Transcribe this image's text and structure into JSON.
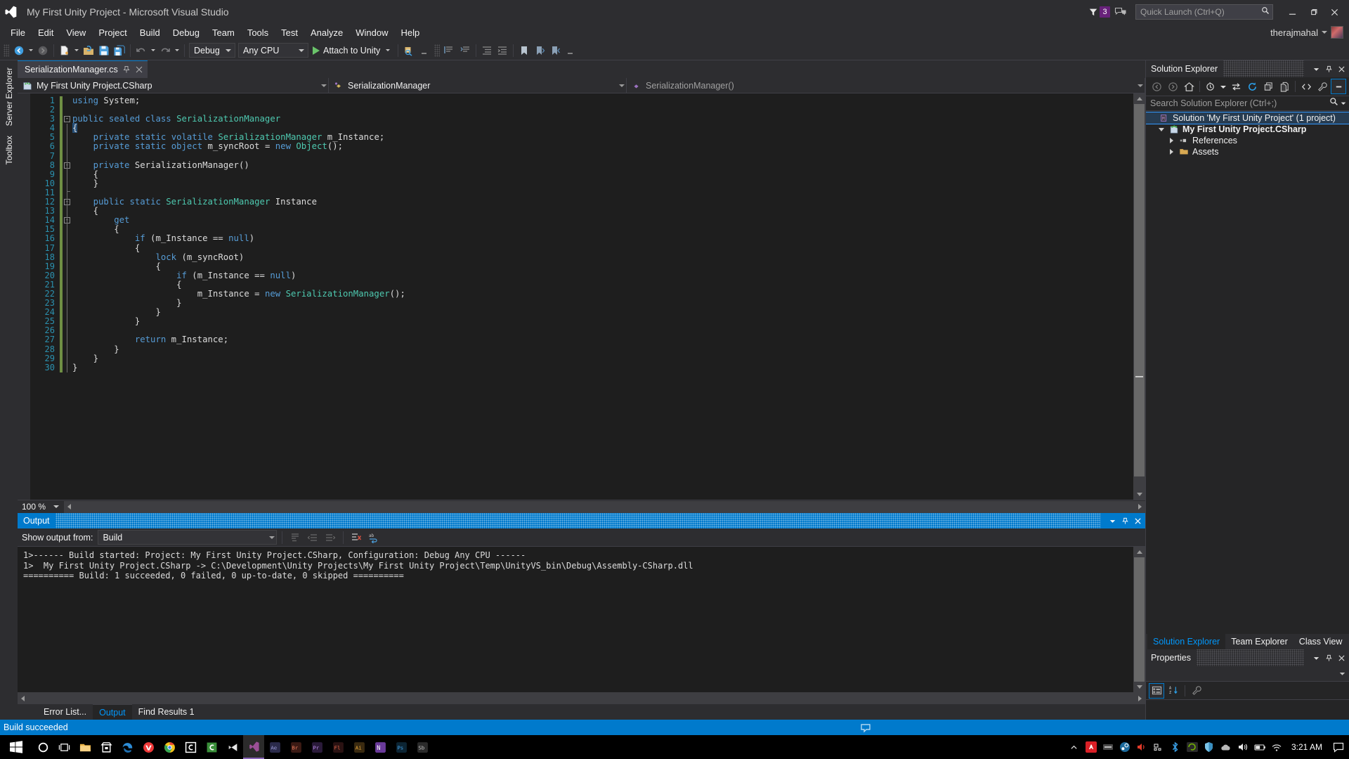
{
  "window": {
    "title": "My First Unity Project - Microsoft Visual Studio",
    "logo_icon": "visual-studio-logo",
    "minimize_icon": "minimize-icon",
    "restore_icon": "restore-icon",
    "close_icon": "close-icon"
  },
  "titlebar": {
    "notification_icon": "funnel-icon",
    "notification_count": "3",
    "feedback_icon": "feedback-icon",
    "quick_launch_placeholder": "Quick Launch (Ctrl+Q)",
    "quick_launch_value": "",
    "search_icon": "magnifier-icon"
  },
  "account": {
    "user_name": "therajmahal",
    "dropdown_icon": "chevron-down-icon",
    "avatar": "user-avatar"
  },
  "menu": {
    "items": [
      {
        "label": "File"
      },
      {
        "label": "Edit"
      },
      {
        "label": "View"
      },
      {
        "label": "Project"
      },
      {
        "label": "Build"
      },
      {
        "label": "Debug"
      },
      {
        "label": "Team"
      },
      {
        "label": "Tools"
      },
      {
        "label": "Test"
      },
      {
        "label": "Analyze"
      },
      {
        "label": "Window"
      },
      {
        "label": "Help"
      }
    ]
  },
  "toolbar": {
    "navigate_back_icon": "navigate-back-icon",
    "navigate_forward_icon": "navigate-forward-icon",
    "new_item_icon": "new-item-icon",
    "open_file_icon": "open-file-icon",
    "save_icon": "save-icon",
    "save_all_icon": "save-all-icon",
    "undo_icon": "undo-icon",
    "redo_icon": "redo-icon",
    "config_value": "Debug",
    "platform_value": "Any CPU",
    "run_label": "Attach to Unity",
    "run_icon": "play-triangle-icon",
    "find_icon": "find-in-files-icon",
    "comment_icon": "comment-icon",
    "uncomment_icon": "uncomment-icon",
    "indent_icon": "increase-indent-icon",
    "outdent_icon": "decrease-indent-icon",
    "bookmark_icon": "bookmark-icon",
    "prev_bookmark_icon": "previous-bookmark-icon",
    "next_bookmark_icon": "next-bookmark-icon",
    "overflow_icon": "toolbar-overflow-icon"
  },
  "left_dock": {
    "tabs": [
      {
        "label": "Server Explorer"
      },
      {
        "label": "Toolbox"
      }
    ]
  },
  "editor": {
    "tab_label": "SerializationManager.cs",
    "tab_pin_icon": "pin-icon",
    "tab_close_icon": "close-icon",
    "breadcrumb": {
      "project": "My First Unity Project.CSharp",
      "project_icon": "csharp-project-icon",
      "type": "SerializationManager",
      "type_icon": "class-icon",
      "member": "SerializationManager()",
      "member_icon": "method-icon"
    },
    "zoom_level": "100 %",
    "line_numbers": [
      1,
      2,
      3,
      4,
      5,
      6,
      7,
      8,
      9,
      10,
      11,
      12,
      13,
      14,
      15,
      16,
      17,
      18,
      19,
      20,
      21,
      22,
      23,
      24,
      25,
      26,
      27,
      28,
      29,
      30
    ],
    "lines": [
      {
        "n": 1,
        "indent": 0,
        "tokens": [
          {
            "t": "using ",
            "c": "kw"
          },
          {
            "t": "System;",
            "c": "pl"
          }
        ]
      },
      {
        "n": 2,
        "indent": 0,
        "tokens": []
      },
      {
        "n": 3,
        "indent": 0,
        "fold": "minus",
        "tokens": [
          {
            "t": "public ",
            "c": "kw"
          },
          {
            "t": "sealed ",
            "c": "kw"
          },
          {
            "t": "class ",
            "c": "kw"
          },
          {
            "t": "SerializationManager",
            "c": "type"
          }
        ]
      },
      {
        "n": 4,
        "indent": 0,
        "tokens": [
          {
            "t": "{",
            "c": "cursor"
          }
        ]
      },
      {
        "n": 5,
        "indent": 1,
        "tokens": [
          {
            "t": "private ",
            "c": "kw"
          },
          {
            "t": "static ",
            "c": "kw"
          },
          {
            "t": "volatile ",
            "c": "kw"
          },
          {
            "t": "SerializationManager",
            "c": "type"
          },
          {
            "t": " m_Instance;",
            "c": "pl"
          }
        ]
      },
      {
        "n": 6,
        "indent": 1,
        "tokens": [
          {
            "t": "private ",
            "c": "kw"
          },
          {
            "t": "static ",
            "c": "kw"
          },
          {
            "t": "object",
            "c": "kw"
          },
          {
            "t": " m_syncRoot = ",
            "c": "pl"
          },
          {
            "t": "new ",
            "c": "kw"
          },
          {
            "t": "Object",
            "c": "type"
          },
          {
            "t": "();",
            "c": "pl"
          }
        ]
      },
      {
        "n": 7,
        "indent": 0,
        "tokens": []
      },
      {
        "n": 8,
        "indent": 1,
        "fold": "minus",
        "tokens": [
          {
            "t": "private ",
            "c": "kw"
          },
          {
            "t": "SerializationManager",
            "c": "pl"
          },
          {
            "t": "()",
            "c": "pl"
          }
        ]
      },
      {
        "n": 9,
        "indent": 1,
        "tokens": [
          {
            "t": "{",
            "c": "pl"
          }
        ]
      },
      {
        "n": 10,
        "indent": 1,
        "tokens": [
          {
            "t": "}",
            "c": "pl"
          }
        ]
      },
      {
        "n": 11,
        "indent": 0,
        "tokens": []
      },
      {
        "n": 12,
        "indent": 1,
        "fold": "minus",
        "tokens": [
          {
            "t": "public ",
            "c": "kw"
          },
          {
            "t": "static ",
            "c": "kw"
          },
          {
            "t": "SerializationManager",
            "c": "type"
          },
          {
            "t": " Instance",
            "c": "pl"
          }
        ]
      },
      {
        "n": 13,
        "indent": 1,
        "tokens": [
          {
            "t": "{",
            "c": "pl"
          }
        ]
      },
      {
        "n": 14,
        "indent": 2,
        "fold": "minus",
        "tokens": [
          {
            "t": "get",
            "c": "kw"
          }
        ]
      },
      {
        "n": 15,
        "indent": 2,
        "tokens": [
          {
            "t": "{",
            "c": "pl"
          }
        ]
      },
      {
        "n": 16,
        "indent": 3,
        "tokens": [
          {
            "t": "if",
            "c": "kw"
          },
          {
            "t": " (m_Instance == ",
            "c": "pl"
          },
          {
            "t": "null",
            "c": "kw"
          },
          {
            "t": ")",
            "c": "pl"
          }
        ]
      },
      {
        "n": 17,
        "indent": 3,
        "tokens": [
          {
            "t": "{",
            "c": "pl"
          }
        ]
      },
      {
        "n": 18,
        "indent": 4,
        "tokens": [
          {
            "t": "lock",
            "c": "kw"
          },
          {
            "t": " (m_syncRoot)",
            "c": "pl"
          }
        ]
      },
      {
        "n": 19,
        "indent": 4,
        "tokens": [
          {
            "t": "{",
            "c": "pl"
          }
        ]
      },
      {
        "n": 20,
        "indent": 5,
        "tokens": [
          {
            "t": "if",
            "c": "kw"
          },
          {
            "t": " (m_Instance == ",
            "c": "pl"
          },
          {
            "t": "null",
            "c": "kw"
          },
          {
            "t": ")",
            "c": "pl"
          }
        ]
      },
      {
        "n": 21,
        "indent": 5,
        "tokens": [
          {
            "t": "{",
            "c": "pl"
          }
        ]
      },
      {
        "n": 22,
        "indent": 6,
        "tokens": [
          {
            "t": "m_Instance = ",
            "c": "pl"
          },
          {
            "t": "new ",
            "c": "kw"
          },
          {
            "t": "SerializationManager",
            "c": "type"
          },
          {
            "t": "();",
            "c": "pl"
          }
        ]
      },
      {
        "n": 23,
        "indent": 5,
        "tokens": [
          {
            "t": "}",
            "c": "pl"
          }
        ]
      },
      {
        "n": 24,
        "indent": 4,
        "tokens": [
          {
            "t": "}",
            "c": "pl"
          }
        ]
      },
      {
        "n": 25,
        "indent": 3,
        "tokens": [
          {
            "t": "}",
            "c": "pl"
          }
        ]
      },
      {
        "n": 26,
        "indent": 0,
        "tokens": []
      },
      {
        "n": 27,
        "indent": 3,
        "tokens": [
          {
            "t": "return",
            "c": "kw"
          },
          {
            "t": " m_Instance;",
            "c": "pl"
          }
        ]
      },
      {
        "n": 28,
        "indent": 2,
        "tokens": [
          {
            "t": "}",
            "c": "pl"
          }
        ]
      },
      {
        "n": 29,
        "indent": 1,
        "tokens": [
          {
            "t": "}",
            "c": "pl"
          }
        ]
      },
      {
        "n": 30,
        "indent": 0,
        "tokens": [
          {
            "t": "}",
            "c": "pl"
          }
        ]
      }
    ]
  },
  "output": {
    "panel_title": "Output",
    "dropdown_icon": "chevron-down-icon",
    "pin_icon": "pin-icon",
    "close_icon": "close-icon",
    "show_output_from_label": "Show output from:",
    "source_value": "Build",
    "find_message_icon": "find-message-icon",
    "go_to_previous_icon": "go-to-previous-message-icon",
    "go_to_next_icon": "go-to-next-message-icon",
    "clear_all_icon": "clear-all-icon",
    "toggle_word_wrap_icon": "toggle-word-wrap-icon",
    "lines": [
      "1>------ Build started: Project: My First Unity Project.CSharp, Configuration: Debug Any CPU ------",
      "1>  My First Unity Project.CSharp -> C:\\Development\\Unity Projects\\My First Unity Project\\Temp\\UnityVS_bin\\Debug\\Assembly-CSharp.dll",
      "========== Build: 1 succeeded, 0 failed, 0 up-to-date, 0 skipped =========="
    ]
  },
  "bottom_tabs": [
    {
      "label": "Error List...",
      "active": false
    },
    {
      "label": "Output",
      "active": true
    },
    {
      "label": "Find Results 1",
      "active": false
    }
  ],
  "solution_explorer": {
    "title": "Solution Explorer",
    "dropdown_icon": "chevron-down-icon",
    "pin_icon": "pin-icon",
    "close_icon": "close-icon",
    "toolbar": {
      "back_icon": "navigate-back-icon",
      "forward_icon": "navigate-forward-icon",
      "home_icon": "home-icon",
      "pending_changes_icon": "pending-changes-filter-icon",
      "sync_icon": "sync-with-active-document-icon",
      "refresh_icon": "refresh-icon",
      "collapse_all_icon": "collapse-all-icon",
      "properties_window_icon": "properties-window-icon",
      "show_all_files_icon": "show-all-files-icon",
      "view_code_icon": "view-code-icon",
      "preview_selected_icon": "preview-selected-items-icon"
    },
    "search_placeholder": "Search Solution Explorer (Ctrl+;)",
    "search_value": "",
    "search_icon": "magnifier-icon",
    "search_dropdown_icon": "chevron-down-icon",
    "tree": [
      {
        "label": "Solution 'My First Unity Project' (1 project)",
        "icon": "solution-icon",
        "depth": 0,
        "twist": "none",
        "bold": false,
        "selected": true
      },
      {
        "label": "My First Unity Project.CSharp",
        "icon": "csharp-project-icon",
        "depth": 1,
        "twist": "open",
        "bold": true,
        "selected": false
      },
      {
        "label": "References",
        "icon": "references-icon",
        "depth": 2,
        "twist": "closed",
        "bold": false,
        "selected": false
      },
      {
        "label": "Assets",
        "icon": "folder-icon",
        "depth": 2,
        "twist": "closed",
        "bold": false,
        "selected": false
      }
    ]
  },
  "dock_tabs": [
    {
      "label": "Solution Explorer",
      "active": true
    },
    {
      "label": "Team Explorer",
      "active": false
    },
    {
      "label": "Class View",
      "active": false
    }
  ],
  "properties": {
    "title": "Properties",
    "dropdown_icon": "chevron-down-icon",
    "pin_icon": "pin-icon",
    "close_icon": "close-icon",
    "object_dropdown_icon": "chevron-down-icon",
    "categorized_icon": "categorized-view-icon",
    "alphabetical_icon": "alphabetical-sort-icon",
    "property_pages_icon": "property-pages-icon"
  },
  "statusbar": {
    "message": "Build succeeded",
    "notification_icon": "notification-icon"
  },
  "taskbar": {
    "start_icon": "windows-start-icon",
    "items": [
      {
        "icon": "cortana-search-icon",
        "active": false
      },
      {
        "icon": "task-view-icon",
        "active": false
      },
      {
        "icon": "file-explorer-icon",
        "active": false
      },
      {
        "icon": "microsoft-store-icon",
        "active": false
      },
      {
        "icon": "microsoft-edge-icon",
        "active": false
      },
      {
        "icon": "vivaldi-browser-icon",
        "active": false
      },
      {
        "icon": "google-chrome-icon",
        "active": false
      },
      {
        "icon": "c-app-icon",
        "active": false
      },
      {
        "icon": "c-app-green-icon",
        "active": false
      },
      {
        "icon": "unity-editor-icon",
        "active": false
      },
      {
        "icon": "visual-studio-icon",
        "active": true
      },
      {
        "icon": "after-effects-icon",
        "active": false
      },
      {
        "icon": "adobe-bridge-icon",
        "active": false
      },
      {
        "icon": "premiere-pro-icon",
        "active": false
      },
      {
        "icon": "fl-studio-icon",
        "active": false
      },
      {
        "icon": "illustrator-icon",
        "active": false
      },
      {
        "icon": "onenote-icon",
        "active": false
      },
      {
        "icon": "photoshop-icon",
        "active": false
      },
      {
        "icon": "substance-icon",
        "active": false
      }
    ],
    "tray": [
      {
        "icon": "show-hidden-icons-icon"
      },
      {
        "icon": "adobe-creative-cloud-icon"
      },
      {
        "icon": "nvidia-icon"
      },
      {
        "icon": "steam-icon"
      },
      {
        "icon": "volume-red-icon"
      },
      {
        "icon": "network-icon"
      },
      {
        "icon": "bluetooth-icon"
      },
      {
        "icon": "nvidia-green-icon"
      },
      {
        "icon": "windows-defender-icon"
      },
      {
        "icon": "onedrive-icon"
      },
      {
        "icon": "speaker-icon"
      },
      {
        "icon": "battery-icon"
      },
      {
        "icon": "wifi-icon"
      }
    ],
    "clock": "3:21 AM",
    "action_center_icon": "action-center-icon"
  },
  "colors": {
    "accent": "#007acc",
    "editor_bg": "#1e1e1e",
    "chrome_bg": "#2d2d30",
    "panel_bg": "#252526",
    "keyword": "#569cd6",
    "type": "#4ec9b0",
    "linenum": "#2b91af",
    "badge": "#68217a",
    "change_green": "#6f8f44"
  }
}
